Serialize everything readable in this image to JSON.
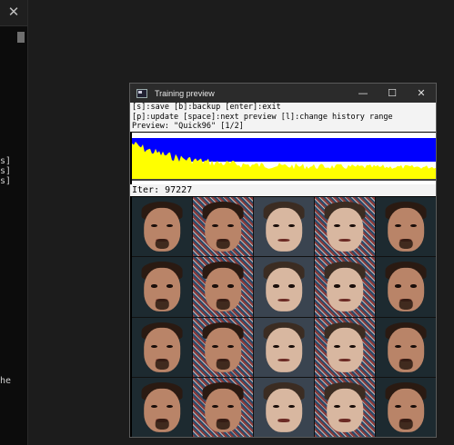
{
  "terminal": {
    "close_glyph": "✕",
    "fragments": [
      "s]",
      "s]",
      "s]",
      "he"
    ]
  },
  "window": {
    "title": "Training preview",
    "minimize_glyph": "—",
    "maximize_glyph": "☐",
    "close_glyph": "✕",
    "help_lines": [
      "[s]:save [b]:backup [enter]:exit",
      "[p]:update [space]:next preview [l]:change history range",
      "Preview: \"Quick96\" [1/2]"
    ],
    "iter_label": "Iter: 97227"
  },
  "colors": {
    "loss_src": "#0000ff",
    "loss_dst": "#ffff00"
  },
  "preview_grid": {
    "rows": [
      [
        "rdj",
        "rdj",
        "elon",
        "elon",
        "rdj"
      ],
      [
        "rdj",
        "rdj",
        "elon",
        "elon",
        "rdj"
      ],
      [
        "rdj",
        "rdj",
        "elon",
        "elon",
        "rdj"
      ],
      [
        "rdj",
        "rdj",
        "elon",
        "elon",
        "rdj"
      ]
    ]
  }
}
